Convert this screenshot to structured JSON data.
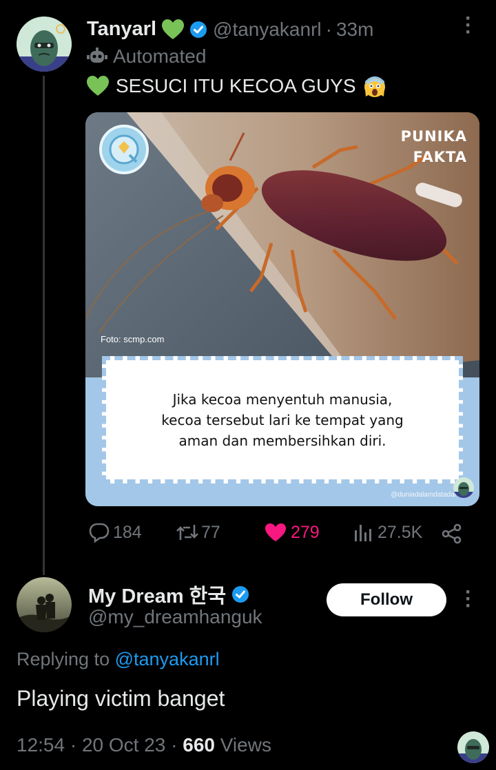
{
  "tweet": {
    "author_name": "Tanyarl",
    "author_handle": "@tanyakanrl",
    "dot": "·",
    "time": "33m",
    "automated_label": "Automated",
    "text": "SESUCI ITU KECOA GUYS",
    "image": {
      "brand_line1": "PUNIKA",
      "brand_line2": "FAKTA",
      "credit": "Foto: scmp.com",
      "caption_line1": "Jika kecoa menyentuh manusia,",
      "caption_line2": "kecoa tersebut lari ke tempat yang",
      "caption_line3": "aman dan membersihkan diri.",
      "watermark": "@duniadalamdatadai"
    },
    "stats": {
      "replies": "184",
      "reposts": "77",
      "likes": "279",
      "views": "27.5K"
    }
  },
  "reply": {
    "author_name": "My Dream 한국",
    "author_handle": "@my_dreamhanguk",
    "follow_label": "Follow",
    "replying_prefix": "Replying to",
    "replying_handle": "@tanyakanrl",
    "text": "Playing victim banget",
    "time": "12:54",
    "dot": "·",
    "date": "20 Oct 23",
    "views_count": "660",
    "views_label": "Views"
  },
  "colors": {
    "background": "#000000",
    "text": "#e7e9ea",
    "muted": "#71767b",
    "link": "#1d9bf0",
    "like": "#f91880",
    "verified": "#1d9bf0",
    "heart": "#78c257"
  }
}
